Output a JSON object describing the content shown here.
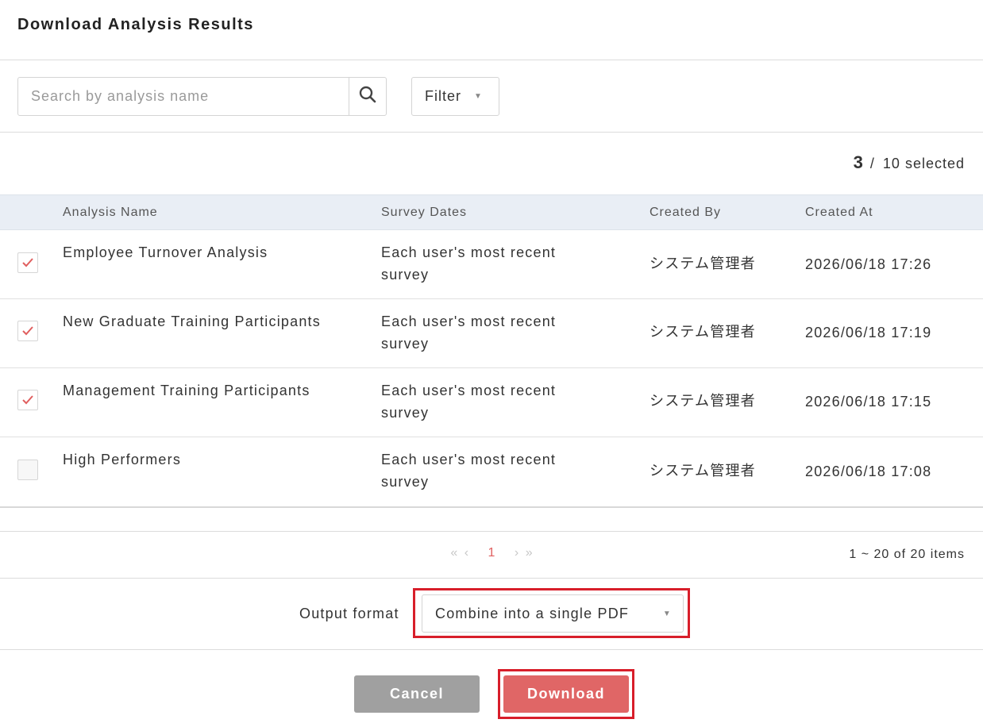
{
  "dialog": {
    "title": "Download Analysis Results"
  },
  "search": {
    "placeholder": "Search by analysis name",
    "value": "",
    "icon": "search-icon"
  },
  "filter": {
    "label": "Filter",
    "icon": "caret-down-icon"
  },
  "selection": {
    "selected": "3",
    "separator": "/",
    "total_label": "10 selected"
  },
  "table": {
    "columns": [
      "Analysis Name",
      "Survey Dates",
      "Created By",
      "Created At"
    ],
    "rows": [
      {
        "checked": true,
        "name": "Employee Turnover Analysis",
        "dates_line1": "Each user's most recent",
        "dates_line2": "survey",
        "created_by": "システム管理者",
        "created_at": "2026/06/18 17:26"
      },
      {
        "checked": true,
        "name": "New Graduate Training Participants",
        "dates_line1": "Each user's most recent",
        "dates_line2": "survey",
        "created_by": "システム管理者",
        "created_at": "2026/06/18 17:19"
      },
      {
        "checked": true,
        "name": "Management Training Participants",
        "dates_line1": "Each user's most recent",
        "dates_line2": "survey",
        "created_by": "システム管理者",
        "created_at": "2026/06/18 17:15"
      },
      {
        "checked": false,
        "name": "High Performers",
        "dates_line1": "Each user's most recent",
        "dates_line2": "survey",
        "created_by": "システム管理者",
        "created_at": "2026/06/18 17:08"
      }
    ]
  },
  "pagination": {
    "first": "«",
    "prev": "‹",
    "current": "1",
    "next": "›",
    "last": "»",
    "items_label": "1 ~ 20 of 20 items"
  },
  "output": {
    "label": "Output format",
    "selected": "Combine into a single PDF"
  },
  "actions": {
    "cancel": "Cancel",
    "download": "Download"
  },
  "colors": {
    "accent": "#e06666",
    "highlight": "#d81e2a",
    "header_bg": "#e9eef5",
    "cancel_bg": "#a0a0a0"
  }
}
